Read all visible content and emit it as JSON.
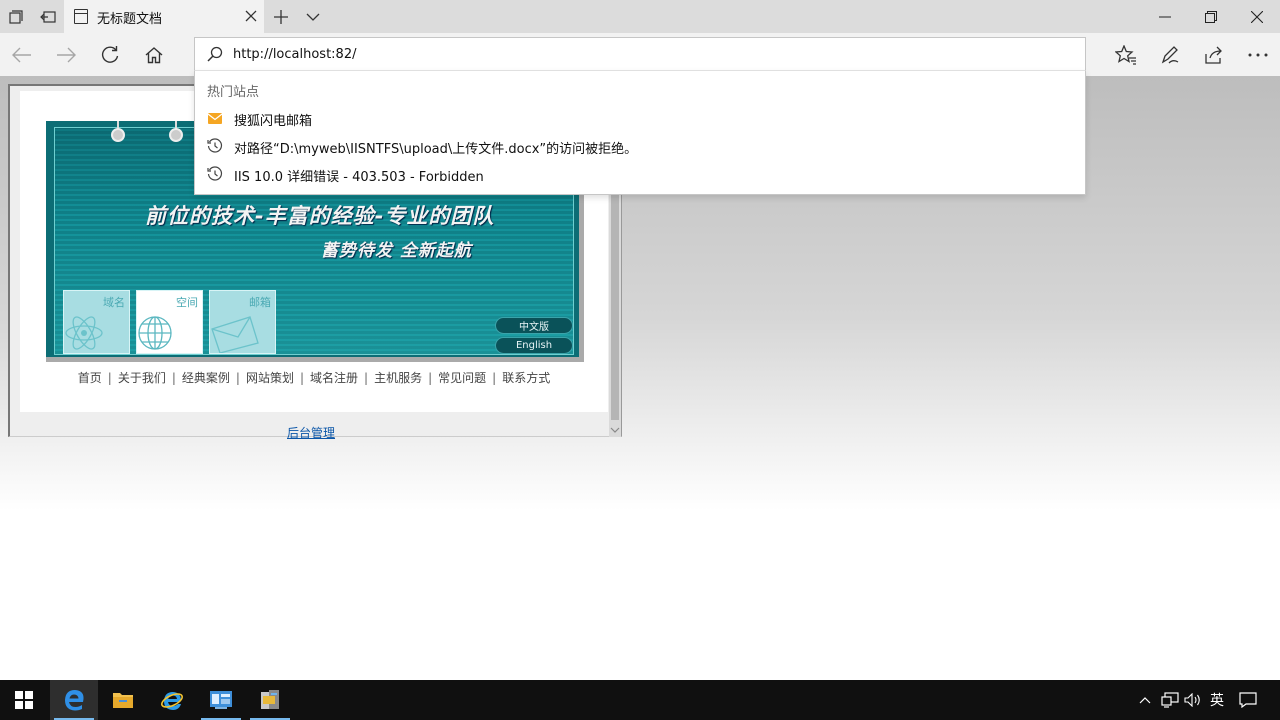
{
  "browser": {
    "tab_title": "无标题文档",
    "address": "http://localhost:82/"
  },
  "dropdown": {
    "header": "热门站点",
    "items": [
      {
        "icon": "mail-icon",
        "text": "搜狐闪电邮箱"
      },
      {
        "icon": "history-icon",
        "text": "对路径“D:\\myweb\\IISNTFS\\upload\\上传文件.docx”的访问被拒绝。"
      },
      {
        "icon": "history-icon",
        "text": "IIS 10.0 详细错误 - 403.503 - Forbidden"
      }
    ]
  },
  "page": {
    "slogan": "前位的技术-丰富的经验-专业的团队",
    "slogan2": "蓄势待发 全新起航",
    "services": [
      "域名",
      "空间",
      "邮箱"
    ],
    "lang_buttons": [
      "中文版",
      "English"
    ],
    "nav": [
      "首页",
      "关于我们",
      "经典案例",
      "网站策划",
      "域名注册",
      "主机服务",
      "常见问题",
      "联系方式"
    ],
    "admin_link": "后台管理"
  },
  "taskbar": {
    "ime": "英"
  },
  "colors": {
    "banner": "#0c6d75",
    "link": "#0b56a8",
    "taskbar": "#101010",
    "tab_bar": "#dcdcdc"
  }
}
